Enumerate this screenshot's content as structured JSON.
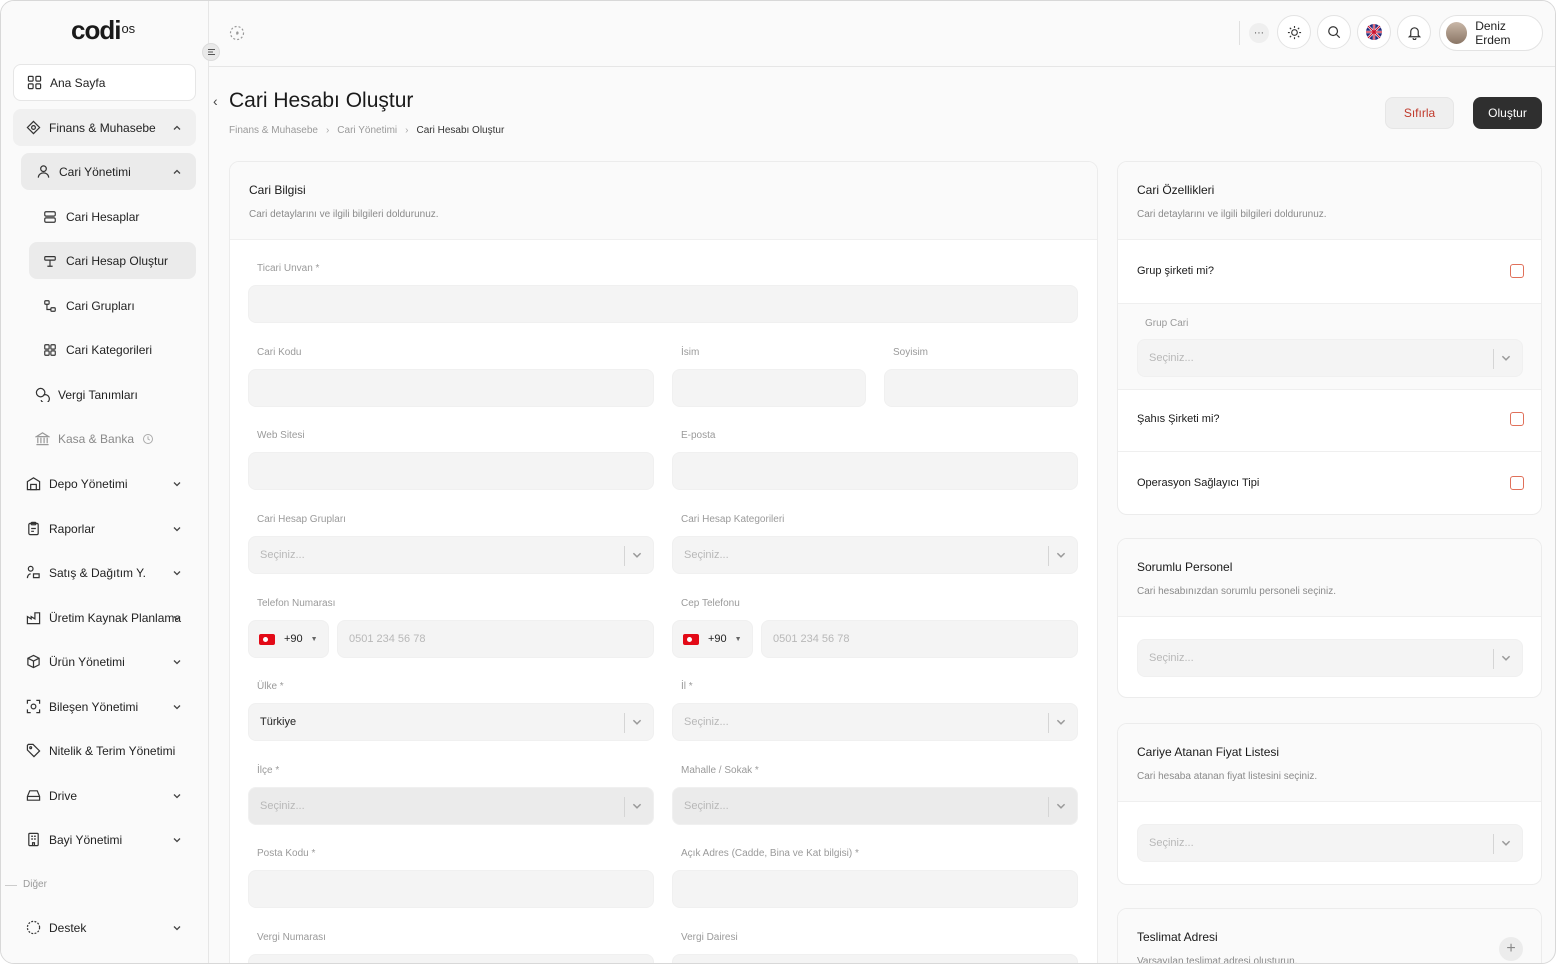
{
  "brand": {
    "logo_main": "codi",
    "logo_sup": "os"
  },
  "sidebar": {
    "items": [
      {
        "label": "Ana Sayfa"
      },
      {
        "label": "Finans & Muhasebe"
      },
      {
        "label": "Cari Yönetimi"
      },
      {
        "label": "Cari Hesaplar"
      },
      {
        "label": "Cari Hesap Oluştur"
      },
      {
        "label": "Cari Grupları"
      },
      {
        "label": "Cari Kategorileri"
      },
      {
        "label": "Vergi Tanımları"
      },
      {
        "label": "Kasa & Banka"
      },
      {
        "label": "Depo Yönetimi"
      },
      {
        "label": "Raporlar"
      },
      {
        "label": "Satış & Dağıtım Y."
      },
      {
        "label": "Üretim Kaynak Planlama"
      },
      {
        "label": "Ürün Yönetimi"
      },
      {
        "label": "Bileşen Yönetimi"
      },
      {
        "label": "Nitelik & Terim Yönetimi"
      },
      {
        "label": "Drive"
      },
      {
        "label": "Bayi Yönetimi"
      },
      {
        "label": "Destek"
      }
    ],
    "section_other": "Diğer"
  },
  "topbar": {
    "user_name": "Deniz Erdem"
  },
  "page": {
    "title": "Cari Hesabı Oluştur",
    "breadcrumb": [
      "Finans & Muhasebe",
      "Cari Yönetimi",
      "Cari Hesabı Oluştur"
    ],
    "reset_label": "Sıfırla",
    "create_label": "Oluştur"
  },
  "form": {
    "title": "Cari Bilgisi",
    "subtitle": "Cari detaylarını ve ilgili bilgileri doldurunuz.",
    "ticari_unvan": "Ticari Unvan *",
    "cari_kodu": "Cari Kodu",
    "isim": "İsim",
    "soyisim": "Soyisim",
    "web_sitesi": "Web Sitesi",
    "eposta": "E-posta",
    "cari_hesap_gruplari": "Cari Hesap Grupları",
    "cari_hesap_kategorileri": "Cari Hesap Kategorileri",
    "select_placeholder": "Seçiniz...",
    "telefon": "Telefon Numarası",
    "cep": "Cep Telefonu",
    "phone_code": "+90",
    "phone_placeholder": "0501 234 56 78",
    "ulke": "Ülke *",
    "ulke_value": "Türkiye",
    "il": "İl *",
    "ilce": "İlçe *",
    "mahalle": "Mahalle / Sokak *",
    "posta_kodu": "Posta Kodu *",
    "acik_adres": "Açık Adres (Cadde, Bina ve Kat bilgisi) *",
    "vergi_numarasi": "Vergi Numarası",
    "vergi_dairesi": "Vergi Dairesi"
  },
  "features": {
    "title": "Cari Özellikleri",
    "subtitle": "Cari detaylarını ve ilgili bilgileri doldurunuz.",
    "grup_sirketi": "Grup şirketi mi?",
    "grup_cari": "Grup Cari",
    "sahis_sirketi": "Şahıs Şirketi mi?",
    "operasyon": "Operasyon Sağlayıcı Tipi"
  },
  "personel": {
    "title": "Sorumlu Personel",
    "subtitle": "Cari hesabınızdan sorumlu personeli seçiniz."
  },
  "fiyat": {
    "title": "Cariye Atanan Fiyat Listesi",
    "subtitle": "Cari hesaba atanan fiyat listesini seçiniz."
  },
  "teslimat": {
    "title": "Teslimat Adresi",
    "subtitle": "Varsayılan teslimat adresi oluşturun."
  },
  "colors": {
    "accent_dark": "#2f2f2f",
    "danger": "#c0392b",
    "checkbox": "#e0705a"
  }
}
